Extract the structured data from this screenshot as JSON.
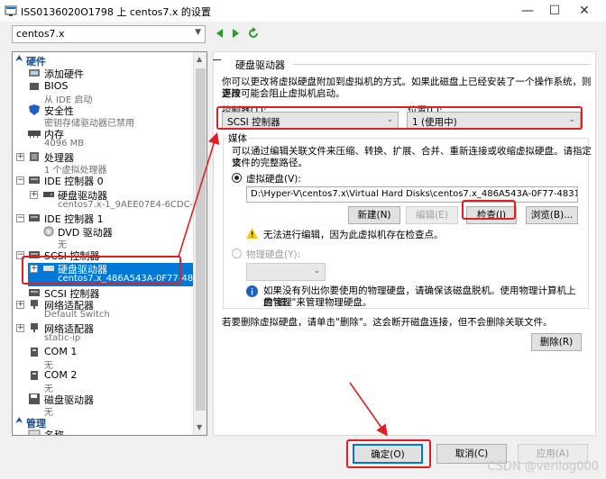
{
  "window": {
    "title": "ISS0136020O1798 上 centos7.x 的设置",
    "controls": [
      "minimize",
      "maximize",
      "close"
    ]
  },
  "toolbar": {
    "vm_selected": "centos7.x"
  },
  "tree": {
    "hardware_header": "硬件",
    "management_header": "管理",
    "items": [
      {
        "label": "添加硬件"
      },
      {
        "label": "BIOS",
        "sub": "从 IDE 启动"
      },
      {
        "label": "安全性",
        "sub": "密钥存储驱动器已禁用"
      },
      {
        "label": "内存",
        "sub": "4096 MB"
      },
      {
        "label": "处理器",
        "sub": "1 个虚拟处理器"
      },
      {
        "label": "IDE 控制器 0"
      },
      {
        "label": "硬盘驱动器",
        "sub": "centos7.x-1_9AEE07E4-6CDC-46B..."
      },
      {
        "label": "IDE 控制器 1"
      },
      {
        "label": "DVD 驱动器",
        "sub": "无"
      },
      {
        "label": "SCSI 控制器"
      },
      {
        "label": "硬盘驱动器",
        "sub": "centos7.x_486A543A-0F77-4831-..."
      },
      {
        "label": "SCSI 控制器"
      },
      {
        "label": "网络适配器",
        "sub": "Default Switch"
      },
      {
        "label": "网络适配器",
        "sub": "static-ip"
      },
      {
        "label": "COM 1",
        "sub": "无"
      },
      {
        "label": "COM 2",
        "sub": "无"
      },
      {
        "label": "磁盘驱动器",
        "sub": "无"
      },
      {
        "label": "名称"
      }
    ]
  },
  "panel": {
    "title": "硬盘驱动器",
    "intro_line1": "你可以更改将虚拟硬盘附加到虚拟机的方式。如果此磁盘上已经安装了一个操作系统，则更改",
    "intro_line2": "连接可能会阻止虚拟机启动。",
    "controller_label": "控制器(T):",
    "location_label": "位置(L):",
    "controller_value": "SCSI 控制器",
    "location_value": "1 (使用中)",
    "media_label": "媒体",
    "media_line1": "可以通过编辑关联文件来压缩、转换、扩展、合并、重新连接或收缩虚拟硬盘。请指定该",
    "media_line2": "文件的完整路径。",
    "vhd_label": "虚拟硬盘(V):",
    "vhd_path": "D:\\Hyper-V\\centos7.x\\Virtual Hard Disks\\centos7.x_486A543A-0F77-4831-8828-CE318D1CBA4F.",
    "new_btn": "新建(N)",
    "edit_btn": "编辑(E)",
    "inspect_btn": "检查(I)",
    "browse_btn": "浏览(B)...",
    "warning_text": "无法进行编辑，因为此虚拟机存在检查点。",
    "physical_label": "物理硬盘(Y):",
    "info_line1": "如果没有列出你要使用的物理硬盘，请确保该磁盘脱机。使用物理计算机上的\"磁",
    "info_line2": "盘管理\"来管理物理硬盘。",
    "remove_text": "若要删除虚拟硬盘，请单击\"删除\"。这会断开磁盘连接，但不会删除关联文件。",
    "remove_btn": "删除(R)"
  },
  "footer": {
    "ok": "确定(O)",
    "cancel": "取消(C)",
    "apply": "应用(A)"
  },
  "watermark": "CSDN @verilog000",
  "colors": {
    "accent": "#0078d7",
    "annotation": "#e02020",
    "header_text": "#1c4f8f"
  }
}
